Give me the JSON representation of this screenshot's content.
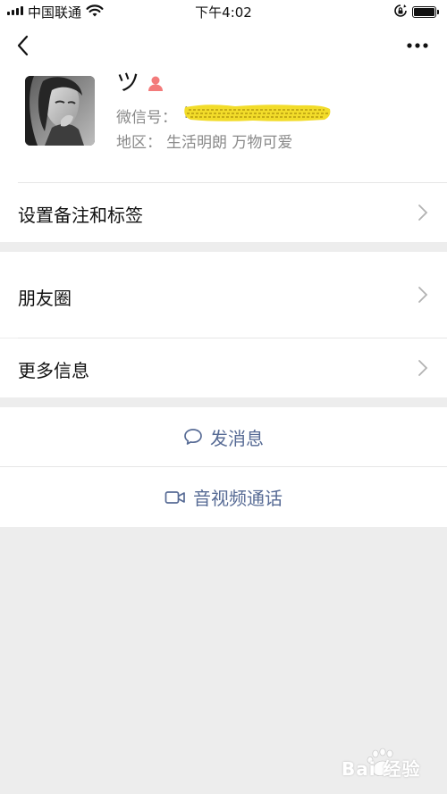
{
  "status_bar": {
    "carrier": "中国联通",
    "time": "下午4:02"
  },
  "profile": {
    "nickname": "ツ",
    "wechat_id_label": "微信号：",
    "wechat_id_value": "b",
    "region_label": "地区：",
    "region_value": "生活明朗 万物可爱"
  },
  "menu": {
    "remark_tags": "设置备注和标签",
    "moments": "朋友圈",
    "more_info": "更多信息"
  },
  "actions": {
    "send_message": "发消息",
    "video_call": "音视频通话"
  },
  "watermark": "Bai 经验",
  "colors": {
    "link_blue": "#576b95",
    "background": "#ededed",
    "gender_female": "#f37b7b"
  }
}
